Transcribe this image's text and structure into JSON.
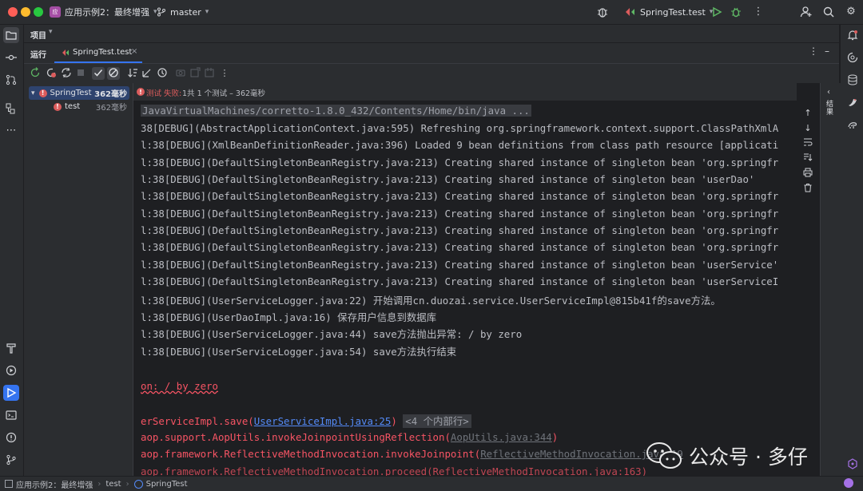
{
  "titlebar": {
    "project_badge": "应",
    "project_name": "应用示例2：最终增强",
    "branch": "master",
    "run_config": "SpringTest.test"
  },
  "left_tools": [
    "folder-icon",
    "commit-icon",
    "pull-request-icon",
    "structure-icon",
    "more-icon"
  ],
  "project_header": {
    "label": "项目"
  },
  "run_tabs": {
    "run_label": "运行",
    "tab_label": "SpringTest.test"
  },
  "test_status": {
    "prefix": "测试 失败:",
    "detail": "1共 1 个测试 – 362毫秒"
  },
  "tree": {
    "root": {
      "name": "SpringTest",
      "time": "362毫秒"
    },
    "child": {
      "name": "test",
      "time": "362毫秒"
    }
  },
  "console": {
    "path_line": "JavaVirtualMachines/corretto-1.8.0_432/Contents/Home/bin/java ...",
    "lines": [
      "38[DEBUG](AbstractApplicationContext.java:595) Refreshing org.springframework.context.support.ClassPathXmlA",
      "l:38[DEBUG](XmlBeanDefinitionReader.java:396) Loaded 9 bean definitions from class path resource [applicati",
      "l:38[DEBUG](DefaultSingletonBeanRegistry.java:213) Creating shared instance of singleton bean 'org.springfr",
      "l:38[DEBUG](DefaultSingletonBeanRegistry.java:213) Creating shared instance of singleton bean 'userDao'",
      "l:38[DEBUG](DefaultSingletonBeanRegistry.java:213) Creating shared instance of singleton bean 'org.springfr",
      "l:38[DEBUG](DefaultSingletonBeanRegistry.java:213) Creating shared instance of singleton bean 'org.springfr",
      "l:38[DEBUG](DefaultSingletonBeanRegistry.java:213) Creating shared instance of singleton bean 'org.springfr",
      "l:38[DEBUG](DefaultSingletonBeanRegistry.java:213) Creating shared instance of singleton bean 'org.springfr",
      "l:38[DEBUG](DefaultSingletonBeanRegistry.java:213) Creating shared instance of singleton bean 'userService'",
      "l:38[DEBUG](DefaultSingletonBeanRegistry.java:213) Creating shared instance of singleton bean 'userServiceI",
      "l:38[DEBUG](UserServiceLogger.java:22) 开始调用cn.duozai.service.UserServiceImpl@815b41f的save方法。",
      "l:38[DEBUG](UserDaoImpl.java:16) 保存用户信息到数据库",
      "l:38[DEBUG](UserServiceLogger.java:44) save方法抛出异常: / by zero",
      "l:38[DEBUG](UserServiceLogger.java:54) save方法执行结束"
    ],
    "exception_line": "on: / by zero",
    "stack1_prefix": "erServiceImpl.save(",
    "stack1_link": "UserServiceImpl.java:25",
    "stack1_suffix": ")",
    "stack1_badge": "<4 个内部行>",
    "stack2_prefix": "aop.support.AopUtils.invokeJoinpointUsingReflection(",
    "stack2_link": "AopUtils.java:344",
    "stack2_suffix": ")",
    "stack3_prefix": "aop.framework.ReflectiveMethodInvocation.invokeJoinpoint(",
    "stack3_link": "ReflectiveMethodInvocation.java:19",
    "stack4": "aop.framework.ReflectiveMethodInvocation.proceed(ReflectiveMethodInvocation.java:163)"
  },
  "right_panel_label": "结果",
  "statusbar": {
    "crumbs": [
      "应用示例2：最终增强",
      "test",
      "SpringTest"
    ]
  },
  "watermark": {
    "text": "公众号 · 多仔"
  },
  "colors": {
    "error": "#db5c5c",
    "link": "#548af7",
    "accent": "#3574f0",
    "run_green": "#5fb865"
  }
}
